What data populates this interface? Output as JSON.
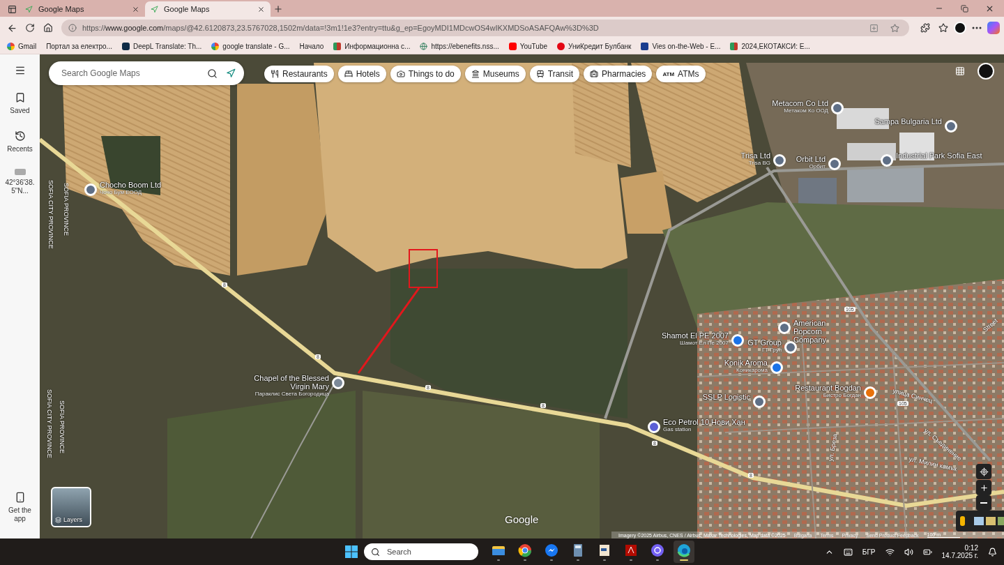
{
  "browser": {
    "tabs": [
      {
        "title": "Google Maps",
        "selected": false
      },
      {
        "title": "Google Maps",
        "selected": true
      }
    ],
    "url": "https://**www.google.com**/maps/@42.6120873,23.5767028,1502m/data=!3m1!1e3?entry=ttu&g_ep=EgoyMDI1MDcwOS4wIKXMDSoASAFQAw%3D%3D",
    "bookmarks": [
      {
        "label": "Gmail",
        "kind": "google"
      },
      {
        "label": "Портал за електро...",
        "kind": "shield"
      },
      {
        "label": "DeepL Translate: Th...",
        "kind": "deepl"
      },
      {
        "label": "google translate - G...",
        "kind": "google"
      },
      {
        "label": "Начало",
        "kind": "shield"
      },
      {
        "label": "Информационна с...",
        "kind": "ni"
      },
      {
        "label": "https://ebenefits.nss...",
        "kind": "globe"
      },
      {
        "label": "YouTube",
        "kind": "youtube"
      },
      {
        "label": "УниКредит Булбанк",
        "kind": "unicredit"
      },
      {
        "label": "Vies on-the-Web - E...",
        "kind": "eu"
      },
      {
        "label": "2024,ЕКОТАКСИ: E...",
        "kind": "ni"
      }
    ]
  },
  "sidebar": {
    "items": [
      {
        "label": "Saved",
        "kind": "saved"
      },
      {
        "label": "Recents",
        "kind": "recents"
      },
      {
        "label": "42°36'38.5\"N...",
        "kind": "place"
      }
    ],
    "get_app": "Get the app"
  },
  "search": {
    "placeholder": "Search Google Maps"
  },
  "chips": [
    {
      "label": "Restaurants",
      "kind": "restaurant"
    },
    {
      "label": "Hotels",
      "kind": "hotel"
    },
    {
      "label": "Things to do",
      "kind": "camera"
    },
    {
      "label": "Museums",
      "kind": "museum"
    },
    {
      "label": "Transit",
      "kind": "transit"
    },
    {
      "label": "Pharmacies",
      "kind": "pharmacy"
    },
    {
      "label": "ATMs",
      "kind": "atm",
      "icon_text": "ATM"
    }
  ],
  "map": {
    "pins": [
      {
        "name": "Metacom Co Ltd",
        "subname": "Метаком Ко ООД",
        "color": "#5f6f86"
      },
      {
        "name": "Sampa Bulgaria Ltd",
        "color": "#5f6f86"
      },
      {
        "name": "Trisa Ltd",
        "subname": "Trisa BG",
        "color": "#5f6f86"
      },
      {
        "name": "Orbit Ltd",
        "subname": "Орбит",
        "color": "#5f6f86"
      },
      {
        "name": "Industrial Park Sofia East",
        "color": "#5f6f86"
      },
      {
        "name": "Chocho Boom Ltd",
        "subname": "Чочо Бум ЕООД",
        "color": "#5f6f86"
      },
      {
        "name": "Shamot El PE 2007",
        "subname": "Шамот Ел Пе 2007",
        "color": "#1a73e8"
      },
      {
        "name": "American Popcorn Company",
        "color": "#5f6f86"
      },
      {
        "name": "GT Group",
        "subname": "ГТ Груп",
        "color": "#5f6f86"
      },
      {
        "name": "Konik Aroma",
        "subname": "Коникарома",
        "color": "#1a73e8"
      },
      {
        "name": "Restaurant Bogdan",
        "subname": "Бистро Богдан",
        "color": "#e8710a"
      },
      {
        "name": "SSLP Logistic",
        "color": "#5f6f86"
      },
      {
        "name": "Eco Petrol 10 Нови Хан",
        "subname": "Gas station",
        "color": "#5b5fd6"
      },
      {
        "name": "Chapel of the Blessed Virgin Mary",
        "subname": "Параклис Света Богородица",
        "color": "#7d8a99"
      }
    ],
    "regions": [
      "SOFIA PROVINCE",
      "SOFIA CITY PROVINCE",
      "SOFIA CITY PROVINCE",
      "SOFIA PROVINCE"
    ],
    "streets": [
      "улица Синчец",
      "ул. Съединение",
      "ул. Милин камък",
      "ул. Бреза",
      "Street"
    ],
    "shields": [
      "8",
      "8",
      "8",
      "8",
      "8",
      "8",
      "105",
      "105"
    ],
    "logo": "Google",
    "layers": "Layers",
    "attribution": "Imagery ©2025 Airbus, CNES / Airbus, Maxar Technologies, Map data ©2025",
    "footer_links": [
      "Bulgaria",
      "Terms",
      "Privacy",
      "Send Product Feedback"
    ],
    "scale": "100 m"
  },
  "taskbar": {
    "search_placeholder": "Search",
    "apps": [
      {
        "kind": "files",
        "selected": false
      },
      {
        "kind": "chrome",
        "selected": false
      },
      {
        "kind": "messenger",
        "selected": false
      },
      {
        "kind": "calculator",
        "selected": false
      },
      {
        "kind": "document",
        "selected": false
      },
      {
        "kind": "pdf",
        "selected": false
      },
      {
        "kind": "viber",
        "selected": false
      },
      {
        "kind": "edge",
        "selected": true
      }
    ],
    "language": "БГР",
    "time": "0:12",
    "date": "14.7.2025 г."
  }
}
